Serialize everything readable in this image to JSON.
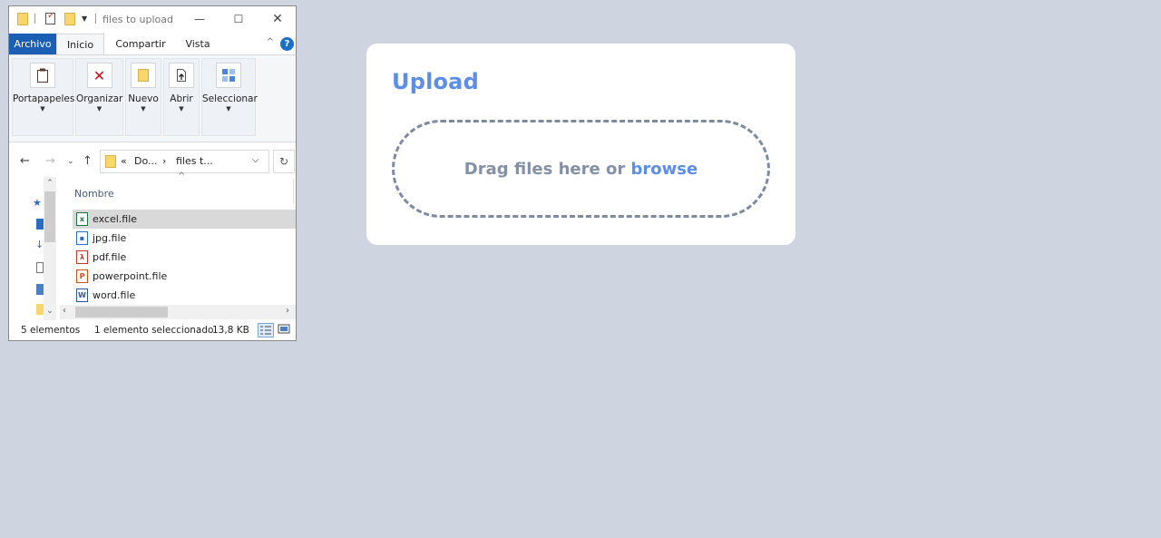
{
  "explorer": {
    "title": "files to upload",
    "ribbon_tabs": [
      {
        "label": "Archivo"
      },
      {
        "label": "Inicio"
      },
      {
        "label": "Compartir"
      },
      {
        "label": "Vista"
      }
    ],
    "help_label": "?",
    "ribbon_groups": [
      {
        "label": "Portapapeles",
        "icon": "clipboard-icon"
      },
      {
        "label": "Organizar",
        "icon": "delete-x-icon"
      },
      {
        "label": "Nuevo",
        "icon": "new-folder-icon"
      },
      {
        "label": "Abrir",
        "icon": "open-icon"
      },
      {
        "label": "Seleccionar",
        "icon": "select-grid-icon"
      }
    ],
    "address": {
      "chevrons": "«",
      "segment1": "Do...",
      "separator": "›",
      "segment2": "files t..."
    },
    "column_header": "Nombre",
    "files": [
      {
        "name": "excel.file",
        "icon": "excel-file-icon",
        "glyph": "x",
        "color": "#1e7145",
        "selected": true
      },
      {
        "name": "jpg.file",
        "icon": "image-file-icon",
        "glyph": "▪",
        "color": "#2b6cc4",
        "selected": false
      },
      {
        "name": "pdf.file",
        "icon": "pdf-file-icon",
        "glyph": "λ",
        "color": "#c0392b",
        "selected": false
      },
      {
        "name": "powerpoint.file",
        "icon": "powerpoint-file-icon",
        "glyph": "P",
        "color": "#c9501c",
        "selected": false
      },
      {
        "name": "word.file",
        "icon": "word-file-icon",
        "glyph": "W",
        "color": "#2b579a",
        "selected": false
      }
    ],
    "status": {
      "count": "5 elementos",
      "selection": "1 elemento seleccionado",
      "size": "13,8 KB"
    }
  },
  "upload": {
    "title": "Upload",
    "drop_text": "Drag files here or",
    "browse_label": "browse",
    "accent_color": "#5b8ee4"
  }
}
